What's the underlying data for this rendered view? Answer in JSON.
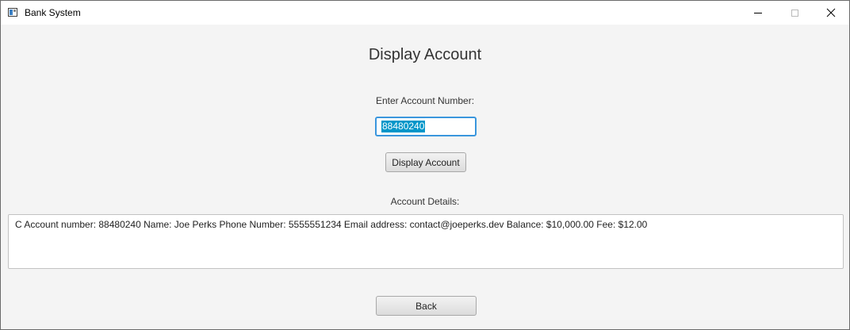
{
  "window": {
    "title": "Bank System",
    "controls": [
      "minimize-icon",
      "maximize-icon",
      "close-icon"
    ]
  },
  "main": {
    "heading": "Display Account",
    "account_label": "Enter Account Number:",
    "account_input_value": "88480240",
    "display_button_label": "Display Account",
    "details_label": "Account Details:",
    "details_text": "C Account number: 88480240 Name: Joe Perks Phone Number: 5555551234 Email address: contact@joeperks.dev Balance: $10,000.00 Fee: $12.00",
    "back_button_label": "Back"
  },
  "colors": {
    "accent": "#3a96dd",
    "selection": "#0096c9",
    "background": "#f4f4f4"
  }
}
